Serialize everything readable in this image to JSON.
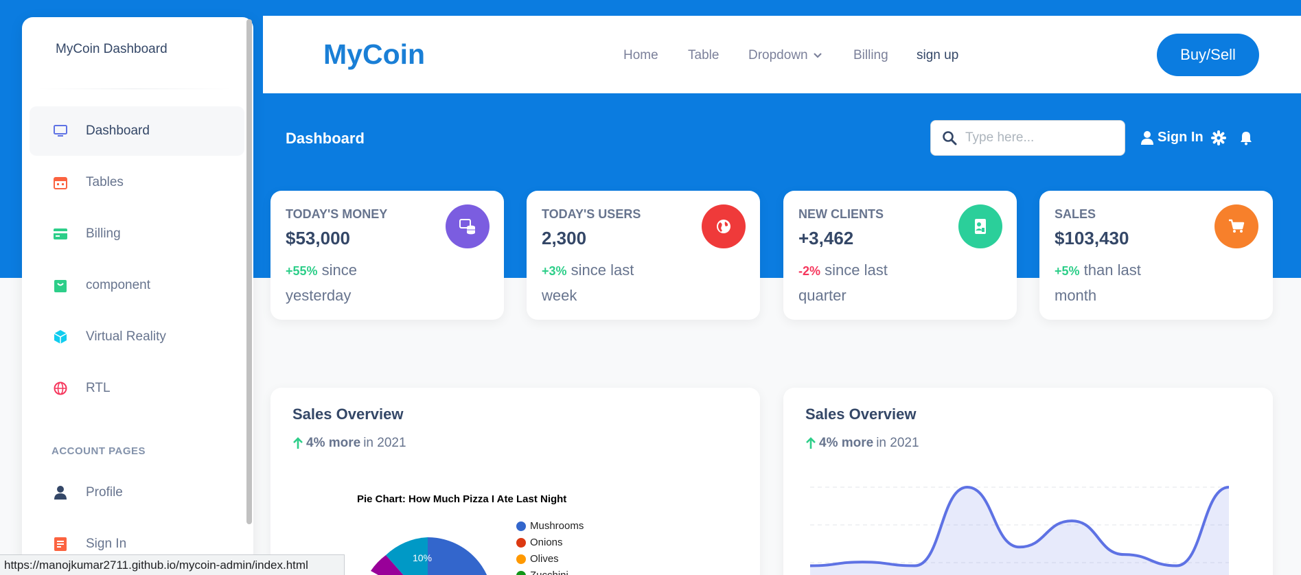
{
  "sidebar": {
    "brand": "MyCoin Dashboard",
    "items": [
      {
        "label": "Dashboard",
        "icon": "desktop-icon",
        "active": true
      },
      {
        "label": "Tables",
        "icon": "calendar-icon"
      },
      {
        "label": "Billing",
        "icon": "credit-card-icon"
      },
      {
        "label": "component",
        "icon": "shopping-bag-icon"
      },
      {
        "label": "Virtual Reality",
        "icon": "cube-icon"
      },
      {
        "label": "RTL",
        "icon": "globe-icon"
      }
    ],
    "section_title": "ACCOUNT PAGES",
    "account_items": [
      {
        "label": "Profile",
        "icon": "user-icon"
      },
      {
        "label": "Sign In",
        "icon": "document-icon"
      }
    ]
  },
  "navbar": {
    "logo": "MyCoin",
    "links": [
      "Home",
      "Table",
      "Dropdown",
      "Billing",
      "sign up"
    ],
    "buy_button": "Buy/Sell"
  },
  "header": {
    "title": "Dashboard",
    "search_placeholder": "Type here...",
    "sign_in": "Sign In"
  },
  "stats": [
    {
      "title": "TODAY'S MONEY",
      "value": "$53,000",
      "change": "+55%",
      "suffix": " since yesterday",
      "trend": "up",
      "color": "#7b5de0",
      "icon": "coins-icon"
    },
    {
      "title": "TODAY'S USERS",
      "value": "2,300",
      "change": "+3%",
      "suffix": " since last week",
      "trend": "up",
      "color": "#ef3a3a",
      "icon": "globe-icon"
    },
    {
      "title": "NEW CLIENTS",
      "value": "+3,462",
      "change": "-2%",
      "suffix": " since last quarter",
      "trend": "down",
      "color": "#2bcf9a",
      "icon": "document-icon"
    },
    {
      "title": "SALES",
      "value": "$103,430",
      "change": "+5%",
      "suffix": " than last month",
      "trend": "up",
      "color": "#f7802b",
      "icon": "cart-icon"
    }
  ],
  "panels": [
    {
      "title": "Sales Overview",
      "change": "4% more",
      "suffix": " in 2021"
    },
    {
      "title": "Sales Overview",
      "change": "4% more",
      "suffix": " in 2021"
    }
  ],
  "chart_data": [
    {
      "type": "pie",
      "title": "Pie Chart: How Much Pizza I Ate Last Night",
      "categories": [
        "Mushrooms",
        "Onions",
        "Olives",
        "Zucchini"
      ],
      "colors": [
        "#3366cc",
        "#dc3912",
        "#ff9900",
        "#109618",
        "#990099",
        "#0099c6"
      ],
      "visible_slice_labels": [
        "10%"
      ]
    },
    {
      "type": "area",
      "x": [
        0,
        1,
        2,
        3,
        4,
        5,
        6,
        7,
        8
      ],
      "series": [
        {
          "values": [
            0.05,
            0.1,
            0.05,
            1.1,
            0.3,
            0.65,
            0.2,
            0.05,
            1.1
          ]
        }
      ],
      "grid": true
    }
  ],
  "status_url": "https://manojkumar2711.github.io/mycoin-admin/index.html"
}
